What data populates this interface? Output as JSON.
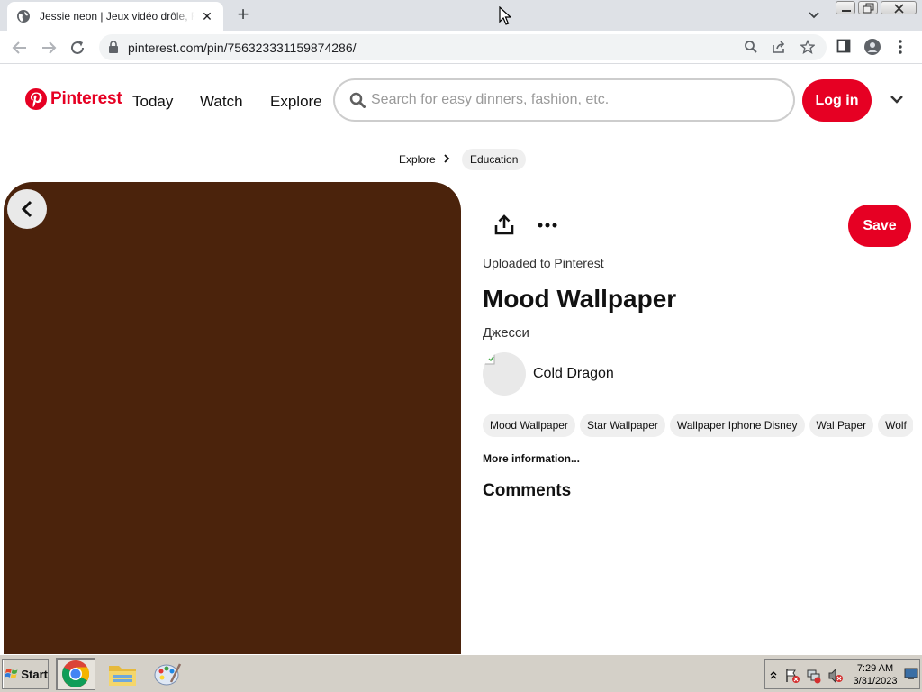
{
  "browser": {
    "tab_title": "Jessie neon | Jeux vidéo drôle, Fond",
    "url": "pinterest.com/pin/756323331159874286/"
  },
  "header": {
    "brand": "Pinterest",
    "nav": [
      "Today",
      "Watch",
      "Explore"
    ],
    "search_placeholder": "Search for easy dinners, fashion, etc.",
    "login_label": "Log in"
  },
  "breadcrumb": {
    "items": [
      "Explore",
      "Education"
    ]
  },
  "pin": {
    "image_color": "#4b230c",
    "save_label": "Save",
    "uploaded": "Uploaded to Pinterest",
    "title": "Mood Wallpaper",
    "description": "Джесси",
    "creator": "Cold Dragon",
    "tags": [
      "Mood Wallpaper",
      "Star Wallpaper",
      "Wallpaper Iphone Disney",
      "Wal Paper",
      "Wolf"
    ],
    "more_info": "More information...",
    "comments_heading": "Comments"
  },
  "taskbar": {
    "start_label": "Start",
    "time": "7:29 AM",
    "date": "3/31/2023"
  },
  "colors": {
    "brand_red": "#e60023"
  }
}
